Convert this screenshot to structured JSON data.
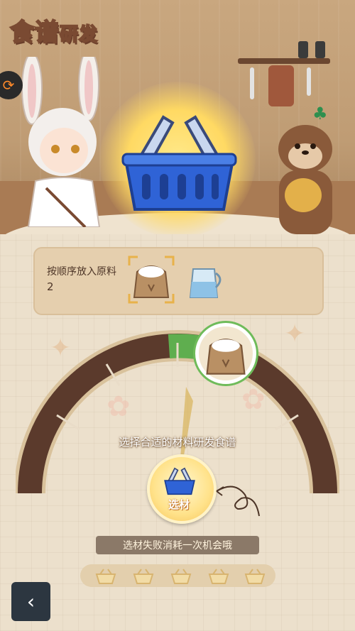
{
  "header": {
    "title_main": "食谱",
    "title_sub": "研发"
  },
  "order": {
    "label": "按顺序放入原料",
    "count": "2",
    "ingredients": [
      "flour-sack-icon",
      "milk-jug-icon"
    ]
  },
  "game": {
    "hint": "选择合适的材料研发食谱",
    "select_button_label": "选材",
    "warning": "选材失败消耗一次机会哦",
    "attempts_total": 5
  },
  "nav": {
    "back_icon": "back-arrow-icon"
  },
  "colors": {
    "gauge_track": "#5b3a2c",
    "gauge_success": "#5fae4f",
    "basket_blue": "#2f63d6",
    "button_gold": "#f6c357"
  }
}
